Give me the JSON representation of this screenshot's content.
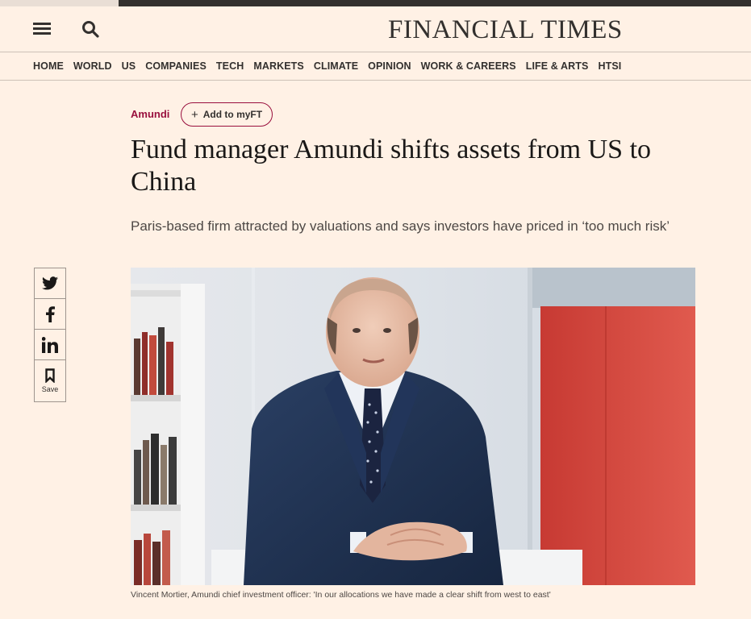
{
  "brand": {
    "masthead": "FINANCIAL TIMES"
  },
  "header": {
    "menu_icon": "hamburger-menu-icon",
    "search_icon": "search-icon"
  },
  "nav": {
    "items": [
      "HOME",
      "WORLD",
      "US",
      "COMPANIES",
      "TECH",
      "MARKETS",
      "CLIMATE",
      "OPINION",
      "WORK & CAREERS",
      "LIFE & ARTS",
      "HTSI"
    ]
  },
  "article": {
    "topic": "Amundi",
    "myft_label": "Add to myFT",
    "headline": "Fund manager Amundi shifts assets from US to China",
    "standfirst": "Paris-based firm attracted by valuations and says investors have priced in ‘too much risk’",
    "caption": "Vincent Mortier, Amundi chief investment officer: 'In our allocations we have made a clear shift from west to east'"
  },
  "share": {
    "icons": [
      "twitter-icon",
      "facebook-icon",
      "linkedin-icon",
      "bookmark-icon"
    ],
    "save_label": "Save"
  },
  "colors": {
    "background": "#fff1e5",
    "accent": "#990f3d",
    "text": "#33302e"
  }
}
